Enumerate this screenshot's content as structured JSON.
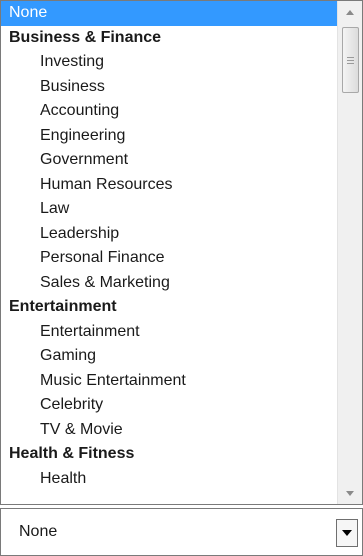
{
  "listbox": {
    "options": [
      {
        "label": "None",
        "kind": "top",
        "selected": true
      },
      {
        "label": "Business & Finance",
        "kind": "group"
      },
      {
        "label": "Investing",
        "kind": "child"
      },
      {
        "label": "Business",
        "kind": "child"
      },
      {
        "label": "Accounting",
        "kind": "child"
      },
      {
        "label": "Engineering",
        "kind": "child"
      },
      {
        "label": "Government",
        "kind": "child"
      },
      {
        "label": "Human Resources",
        "kind": "child"
      },
      {
        "label": "Law",
        "kind": "child"
      },
      {
        "label": "Leadership",
        "kind": "child"
      },
      {
        "label": "Personal Finance",
        "kind": "child"
      },
      {
        "label": "Sales & Marketing",
        "kind": "child"
      },
      {
        "label": "Entertainment",
        "kind": "group"
      },
      {
        "label": "Entertainment",
        "kind": "child"
      },
      {
        "label": "Gaming",
        "kind": "child"
      },
      {
        "label": "Music Entertainment",
        "kind": "child"
      },
      {
        "label": "Celebrity",
        "kind": "child"
      },
      {
        "label": "TV & Movie",
        "kind": "child"
      },
      {
        "label": "Health & Fitness",
        "kind": "group"
      },
      {
        "label": "Health",
        "kind": "child"
      }
    ],
    "selected_color": "#3399ff"
  },
  "select": {
    "value": "None"
  }
}
